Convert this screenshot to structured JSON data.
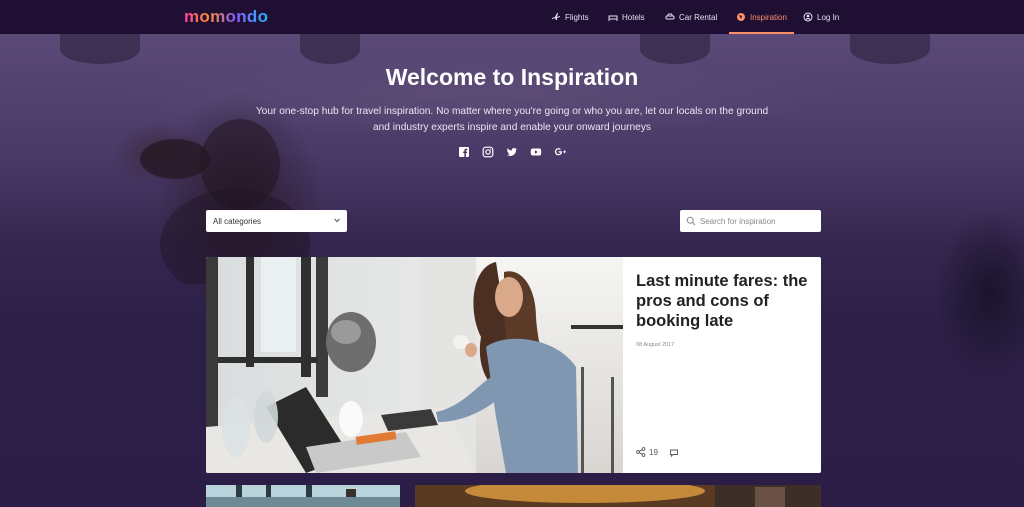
{
  "brand": {
    "logo_text": "momondo"
  },
  "nav": {
    "items": [
      {
        "label": "Flights",
        "icon": "plane-icon"
      },
      {
        "label": "Hotels",
        "icon": "bed-icon"
      },
      {
        "label": "Car Rental",
        "icon": "car-icon"
      },
      {
        "label": "Inspiration",
        "icon": "globe-icon",
        "active": true
      },
      {
        "label": "Log In",
        "icon": "user-icon"
      }
    ]
  },
  "hero": {
    "title": "Welcome to Inspiration",
    "subtitle": "Your one-stop hub for travel inspiration. No matter where you're going or who you are, let our locals on the ground and industry experts inspire and enable your onward journeys",
    "social": [
      "facebook-icon",
      "instagram-icon",
      "twitter-icon",
      "youtube-icon",
      "google-plus-icon"
    ]
  },
  "filters": {
    "category_selected": "All categories",
    "search_placeholder": "Search for inspiration"
  },
  "featured": {
    "title": "Last minute fares: the pros and cons of booking late",
    "date": "08 August 2017",
    "share_count": "19"
  },
  "colors": {
    "nav_bg": "#1e0f33",
    "page_bg": "#2b1d45",
    "active_accent": "#ff8e6a"
  }
}
